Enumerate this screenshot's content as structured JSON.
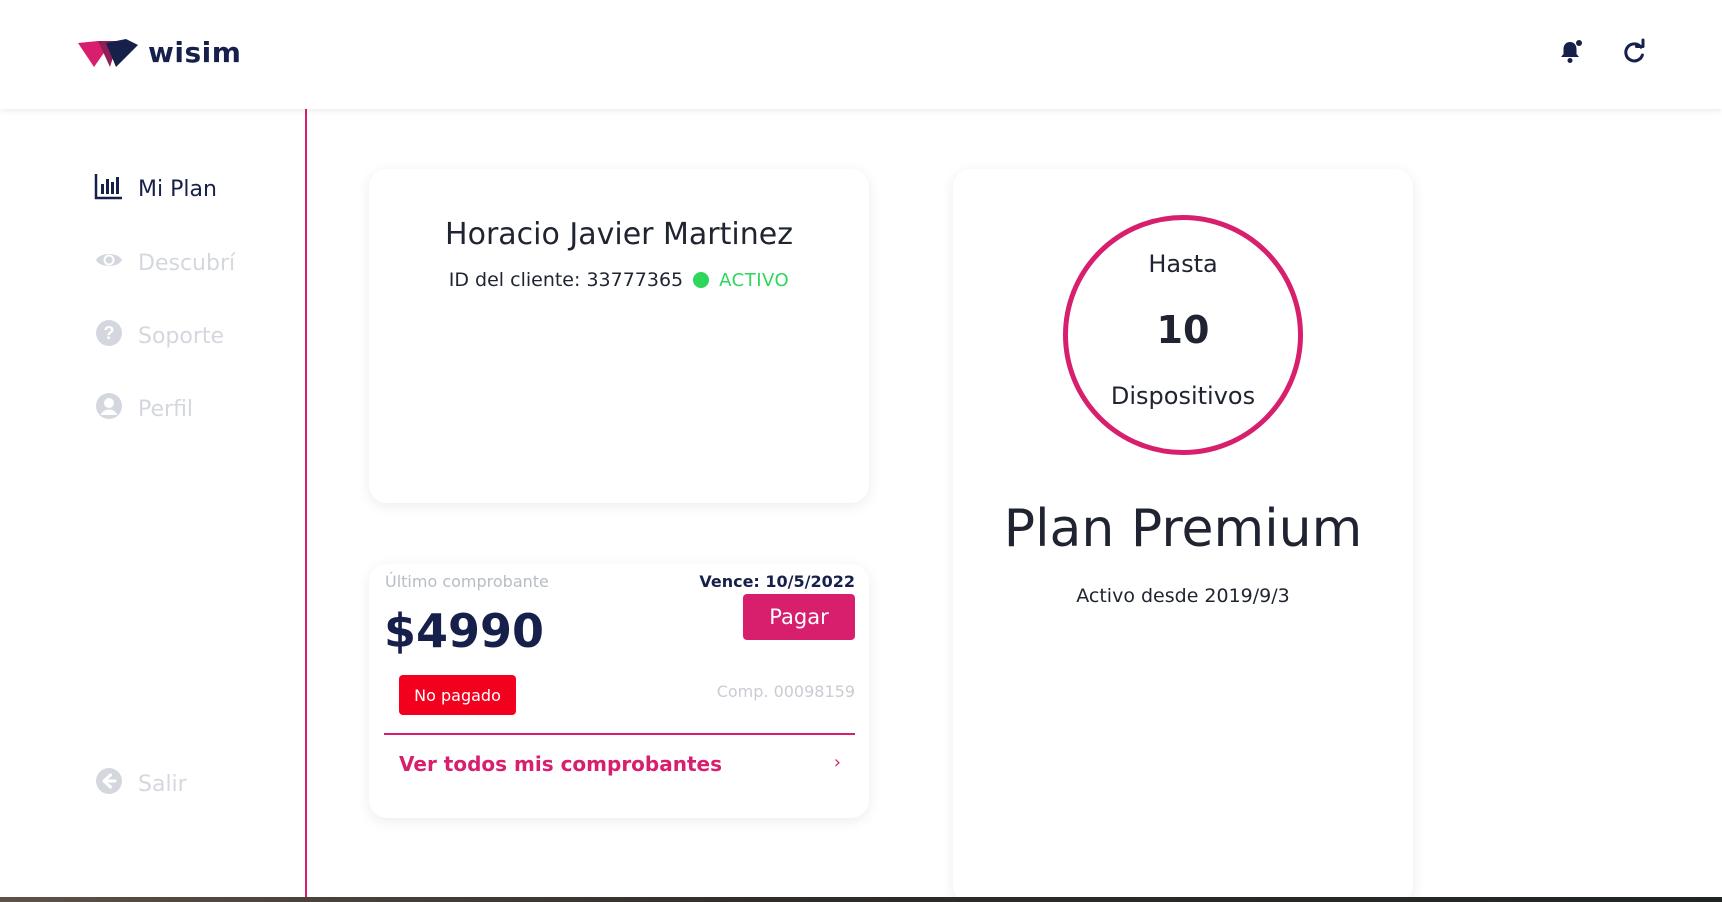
{
  "brand": {
    "name": "wisim",
    "accent": "#d81f6e",
    "navy": "#17204a"
  },
  "header": {
    "icons": [
      "bell-icon",
      "refresh-icon"
    ]
  },
  "sidebar": {
    "items": [
      {
        "label": "Mi Plan",
        "icon": "bar-chart-icon",
        "active": true
      },
      {
        "label": "Descubrí",
        "icon": "eye-icon",
        "active": false
      },
      {
        "label": "Soporte",
        "icon": "question-icon",
        "active": false
      },
      {
        "label": "Perfil",
        "icon": "user-icon",
        "active": false
      }
    ],
    "logout": {
      "label": "Salir",
      "icon": "back-icon"
    }
  },
  "user": {
    "name": "Horacio Javier Martinez",
    "id_label": "ID del cliente: 33777365",
    "status": "ACTIVO",
    "status_color": "#2ed65b"
  },
  "plan": {
    "prefix": "Hasta",
    "devices": "10",
    "suffix": "Dispositivos",
    "name": "Plan Premium",
    "since": "Activo desde 2019/9/3"
  },
  "billing": {
    "label": "Último comprobante",
    "due": "Vence: 10/5/2022",
    "amount": "$4990",
    "pay_label": "Pagar",
    "status": "No pagado",
    "status_color": "#f3001f",
    "comp": "Comp. 00098159",
    "all_link": "Ver todos mis comprobantes",
    "chevron": "›"
  }
}
